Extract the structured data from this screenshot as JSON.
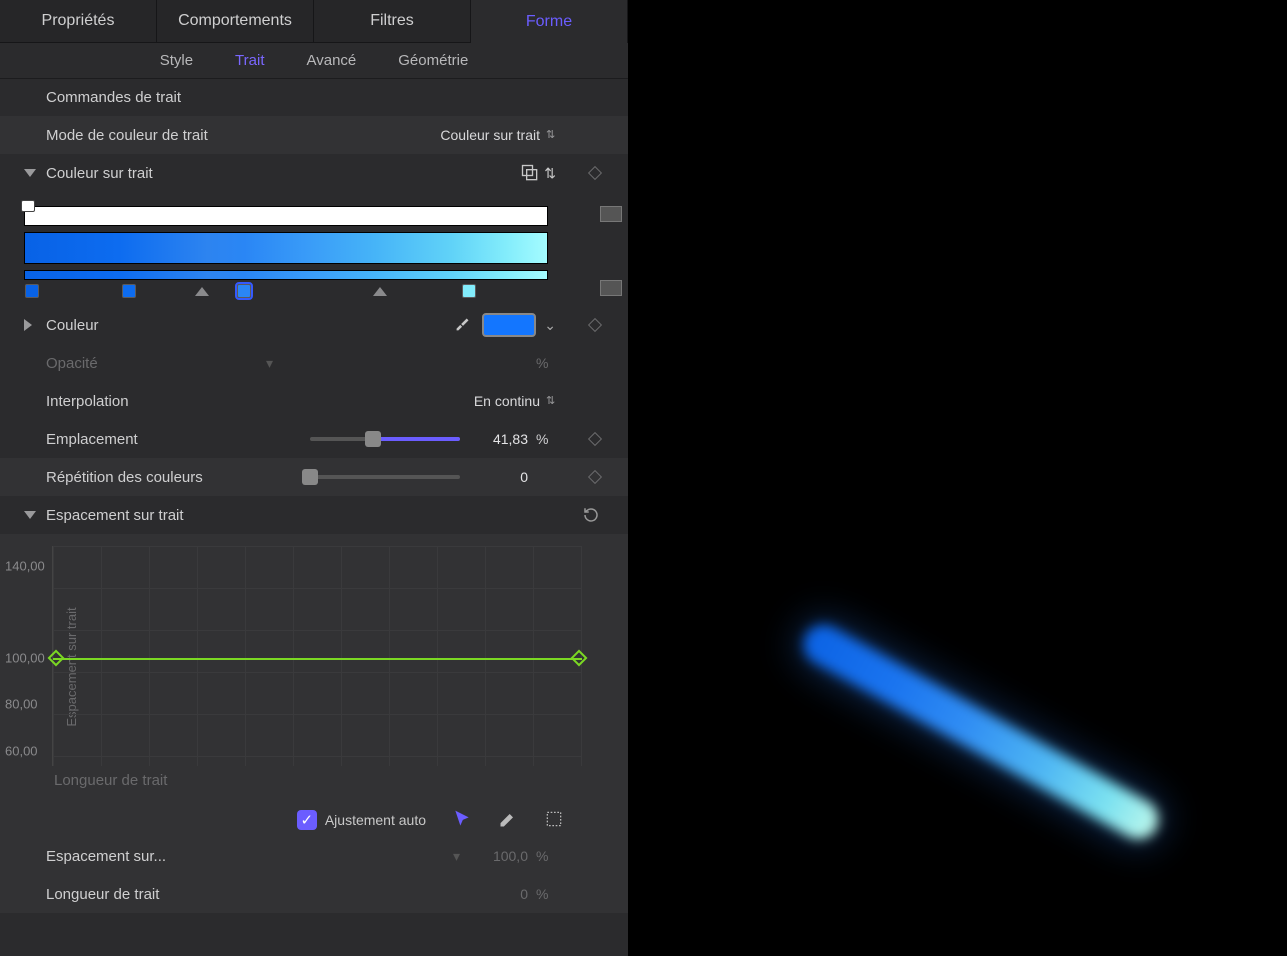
{
  "topTabs": {
    "t0": "Propriétés",
    "t1": "Comportements",
    "t2": "Filtres",
    "t3": "Forme"
  },
  "subTabs": {
    "s0": "Style",
    "s1": "Trait",
    "s2": "Avancé",
    "s3": "Géométrie"
  },
  "sections": {
    "commands": "Commandes de trait",
    "colorMode": {
      "label": "Mode de couleur de trait",
      "value": "Couleur sur trait"
    },
    "colorOnStroke": "Couleur sur trait",
    "couleur": {
      "label": "Couleur",
      "swatchColor": "#1376ff"
    },
    "opacite": {
      "label": "Opacité",
      "unit": "%"
    },
    "interp": {
      "label": "Interpolation",
      "value": "En continu"
    },
    "emplacement": {
      "label": "Emplacement",
      "value": "41,83",
      "unit": "%",
      "pct": 41.83
    },
    "repetition": {
      "label": "Répétition des couleurs",
      "value": "0"
    },
    "spacing": "Espacement sur trait",
    "ylabel": "Espacement sur trait",
    "xlabel": "Longueur de trait",
    "autofit": "Ajustement auto",
    "espSur": {
      "label": "Espacement sur...",
      "value": "100,0",
      "unit": "%"
    },
    "longueur": {
      "label": "Longueur de trait",
      "value": "0",
      "unit": "%"
    }
  },
  "chart_data": {
    "type": "line",
    "title": "Espacement sur trait",
    "xlabel": "Longueur de trait",
    "ylabel": "Espacement sur trait",
    "ylim": [
      50,
      150
    ],
    "yticks": [
      60.0,
      80.0,
      100.0,
      140.0
    ],
    "x": [
      0,
      1
    ],
    "values": [
      100.0,
      100.0
    ]
  },
  "yticks": {
    "y0": "140,00",
    "y1": "100,00",
    "y2": "80,00",
    "y3": "60,00"
  },
  "gradientStops": [
    {
      "pos": 1.5,
      "color": "#0862e6"
    },
    {
      "pos": 20.0,
      "color": "#0d6cf0"
    },
    {
      "pos": 42.0,
      "color": "#2a86f5"
    },
    {
      "pos": 85.0,
      "color": "#82ecfb"
    }
  ],
  "gradientMidpoints": [
    34.0,
    68.0
  ]
}
